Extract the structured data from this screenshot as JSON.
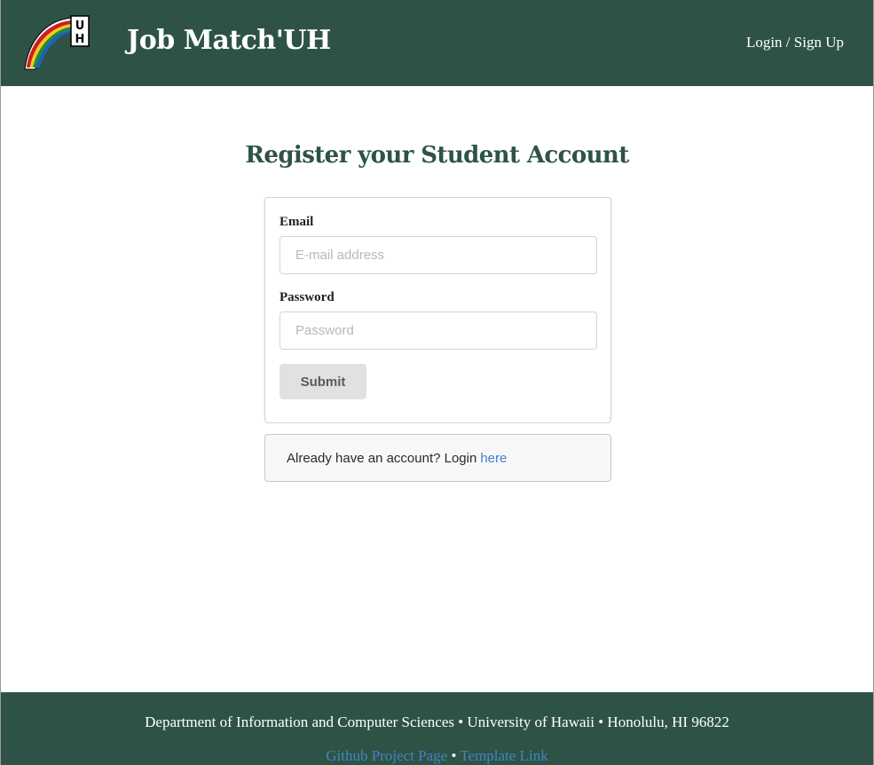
{
  "header": {
    "brand": "Job Match'UH",
    "login_link": "Login / Sign Up",
    "logo_text": "UH"
  },
  "main": {
    "title": "Register your Student Account",
    "email": {
      "label": "Email",
      "placeholder": "E-mail address",
      "value": ""
    },
    "password": {
      "label": "Password",
      "placeholder": "Password",
      "value": ""
    },
    "submit_label": "Submit",
    "login_prompt": "Already have an account? Login",
    "login_link": "here"
  },
  "footer": {
    "address": "Department of Information and Computer Sciences • University of Hawaii • Honolulu, HI 96822",
    "github_link": "Github Project Page",
    "separator": "•",
    "template_link": "Template Link"
  },
  "colors": {
    "primary_green": "#2e5346",
    "link_blue": "#4183c4",
    "button_gray": "#e0e1e2"
  }
}
